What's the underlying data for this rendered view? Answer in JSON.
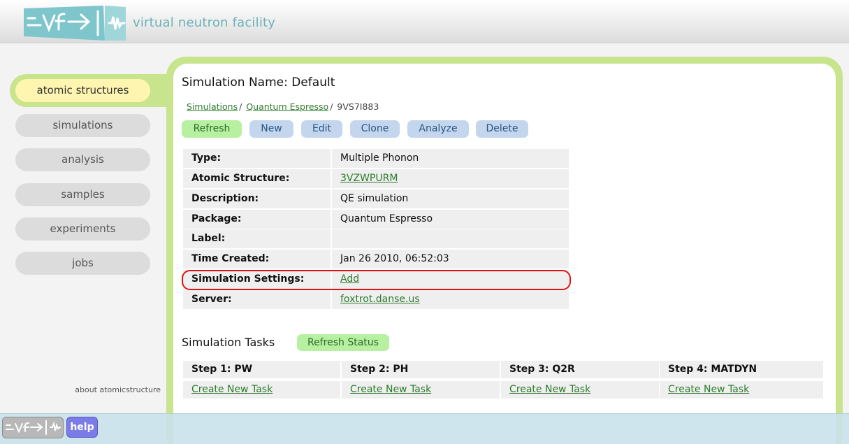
{
  "header": {
    "site_name": "virtual neutron facility"
  },
  "sidebar": {
    "items": [
      {
        "label": "atomic structures",
        "active": true
      },
      {
        "label": "simulations",
        "active": false
      },
      {
        "label": "analysis",
        "active": false
      },
      {
        "label": "samples",
        "active": false
      },
      {
        "label": "experiments",
        "active": false
      },
      {
        "label": "jobs",
        "active": false
      }
    ],
    "about": "about atomicstructure"
  },
  "main": {
    "title": "Simulation Name: Default",
    "breadcrumb": {
      "simulations": "Simulations",
      "package": "Quantum Espresso",
      "id": "9VS7I883"
    },
    "actions": {
      "refresh": "Refresh",
      "new": "New",
      "edit": "Edit",
      "clone": "Clone",
      "analyze": "Analyze",
      "delete": "Delete"
    },
    "details": [
      {
        "key": "Type:",
        "value": "Multiple Phonon",
        "link": false
      },
      {
        "key": "Atomic Structure:",
        "value": "3VZWPURM",
        "link": true
      },
      {
        "key": "Description:",
        "value": "QE simulation",
        "link": false
      },
      {
        "key": "Package:",
        "value": "Quantum Espresso",
        "link": false
      },
      {
        "key": "Label:",
        "value": "",
        "link": false
      },
      {
        "key": "Time Created:",
        "value": "Jan 26 2010, 06:52:03",
        "link": false
      },
      {
        "key": "Simulation Settings:",
        "value": "Add",
        "link": true
      },
      {
        "key": "Server:",
        "value": "foxtrot.danse.us",
        "link": true
      }
    ],
    "tasks": {
      "title": "Simulation Tasks",
      "refresh_status": "Refresh Status",
      "steps": [
        {
          "header": "Step 1: PW",
          "action": "Create New Task"
        },
        {
          "header": "Step 2: PH",
          "action": "Create New Task"
        },
        {
          "header": "Step 3: Q2R",
          "action": "Create New Task"
        },
        {
          "header": "Step 4: MATDYN",
          "action": "Create New Task"
        }
      ]
    }
  },
  "footer": {
    "help": "help"
  },
  "colors": {
    "accent_green": "#c8e48c",
    "link_green": "#2d7a2d",
    "button_blue": "#c3d6ee",
    "button_green": "#b6f0a0",
    "highlight_red": "#e01010",
    "help_purple": "#7c7ce8"
  }
}
